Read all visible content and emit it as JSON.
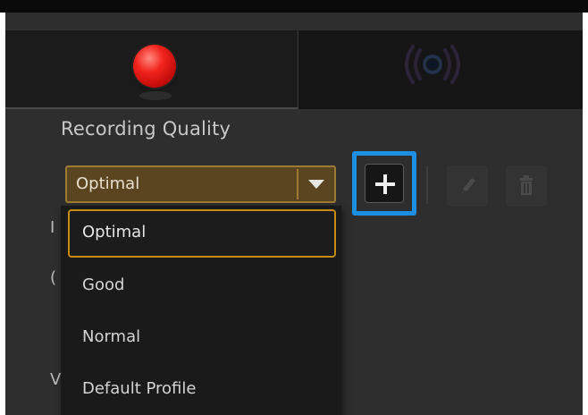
{
  "tabs": [
    {
      "name": "record",
      "icon": "record-dot-icon",
      "active": true
    },
    {
      "name": "broadcast",
      "icon": "broadcast-icon",
      "active": false
    }
  ],
  "recording_quality": {
    "label": "Recording Quality",
    "selected": "Optimal",
    "options": [
      "Optimal",
      "Good",
      "Normal",
      "Default Profile"
    ]
  },
  "toolbar": {
    "add_icon": "plus-icon",
    "edit_icon": "pencil-icon",
    "delete_icon": "trash-icon"
  },
  "colors": {
    "record_red": "#e01b14",
    "highlight_blue": "#1d8fe2",
    "select_border": "#9c7b34",
    "dropdown_selected_border": "#c98a12"
  }
}
